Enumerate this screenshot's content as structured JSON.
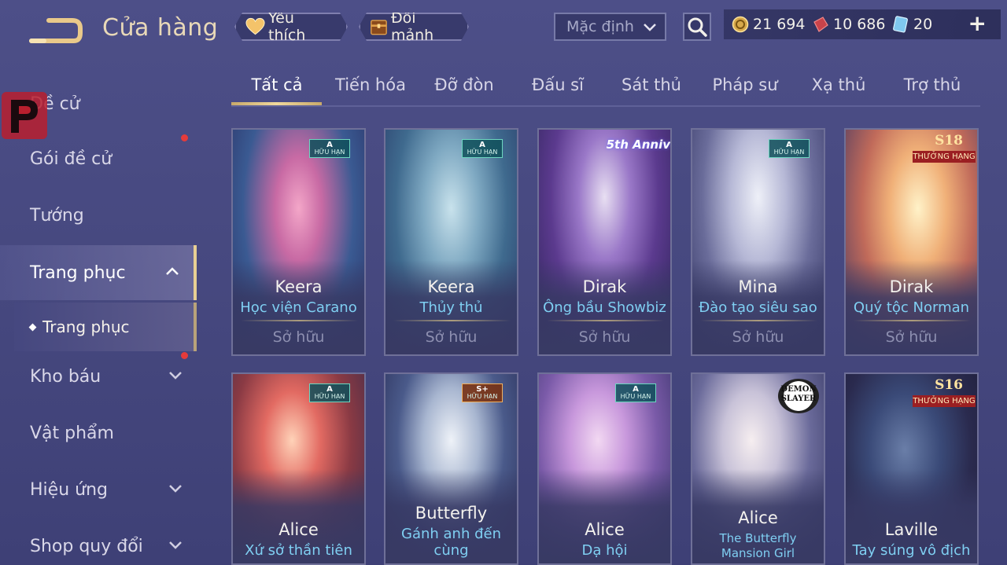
{
  "header": {
    "title": "Cửa hàng",
    "favorites_label": "Yêu thích",
    "exchange_label": "Đổi mảnh",
    "sort_value": "Mặc định",
    "currencies": [
      {
        "name": "gold-coins",
        "value": "21 694"
      },
      {
        "name": "vouchers",
        "value": "10 686"
      },
      {
        "name": "gems",
        "value": "20"
      }
    ],
    "plus": "+"
  },
  "sidebar": {
    "items": [
      {
        "label": "Đề cử"
      },
      {
        "label": "Gói đề cử"
      },
      {
        "label": "Tướng"
      },
      {
        "label": "Trang phục"
      },
      {
        "label": "Kho báu"
      },
      {
        "label": "Vật phẩm"
      },
      {
        "label": "Hiệu ứng"
      },
      {
        "label": "Shop quy đổi"
      }
    ],
    "sub_item": "Trang phục"
  },
  "tabs": [
    "Tất cả",
    "Tiến hóa",
    "Đỡ đòn",
    "Đấu sĩ",
    "Sát thủ",
    "Pháp sư",
    "Xạ thủ",
    "Trợ thủ"
  ],
  "cards": [
    {
      "hero": "Keera",
      "skin": "Học viện Carano",
      "status": "Sở hữu",
      "tag_grade": "A",
      "tag_text": "HỮU HẠN"
    },
    {
      "hero": "Keera",
      "skin": "Thủy thủ",
      "status": "Sở hữu",
      "tag_grade": "A",
      "tag_text": "HỮU HẠN"
    },
    {
      "hero": "Dirak",
      "skin": "Ông bầu Showbiz",
      "status": "Sở hữu",
      "badge": "5th Anniv"
    },
    {
      "hero": "Mina",
      "skin": "Đào tạo siêu sao",
      "status": "Sở hữu",
      "tag_grade": "A",
      "tag_text": "HỮU HẠN"
    },
    {
      "hero": "Dirak",
      "skin": "Quý tộc Norman",
      "status": "Sở hữu",
      "rank_season": "S18",
      "rank_text": "THƯỞNG HẠNG"
    },
    {
      "hero": "Alice",
      "skin": "Xứ sở thần tiên",
      "tag_grade": "A",
      "tag_text": "HỮU HẠN"
    },
    {
      "hero": "Butterfly",
      "skin": "Gánh anh đến cùng",
      "tag_grade": "S+",
      "tag_text": "HỮU HẠN"
    },
    {
      "hero": "Alice",
      "skin": "Dạ hội",
      "tag_grade": "A",
      "tag_text": "HỮU HẠN"
    },
    {
      "hero": "Alice",
      "skin": "The Butterfly Mansion Girl",
      "badge": "DEMON SLAYER"
    },
    {
      "hero": "Laville",
      "skin": "Tay súng vô địch",
      "rank_season": "S16",
      "rank_text": "THƯỞNG HẠNG"
    }
  ],
  "colors": {
    "accent_gold": "#e8cf93",
    "skin_name": "#7fcff2",
    "background": "#4d4f88",
    "notification_dot": "#e53b3b"
  }
}
